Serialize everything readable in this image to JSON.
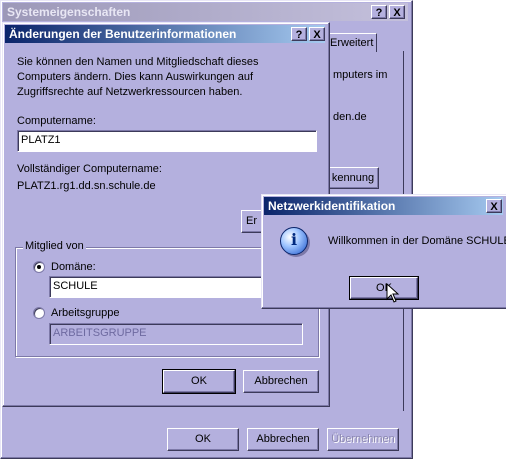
{
  "system_properties": {
    "title": "Systemeigenschaften",
    "help_btn": "?",
    "close_btn": "X",
    "tab_label": "Erweitert",
    "bg_text_1": "mputers im",
    "bg_text_2": "den.de",
    "bg_button": "kennung",
    "ok": "OK",
    "cancel": "Abbrechen",
    "apply": "Übernehmen"
  },
  "user_info_dialog": {
    "title": "Änderungen der Benutzerinformationen",
    "help_btn": "?",
    "close_btn": "X",
    "description": "Sie können den Namen und Mitgliedschaft dieses Computers ändern. Dies kann Auswirkungen auf Zugriffsrechte auf Netzwerkressourcen haben.",
    "computer_name_label": "Computername:",
    "computer_name_value": "PLATZ1",
    "full_name_label": "Vollständiger Computername:",
    "full_name_value": "PLATZ1.rg1.dd.sn.schule.de",
    "more_button": "Er",
    "member_of_label": "Mitglied von",
    "domain_label": "Domäne:",
    "domain_value": "SCHULE",
    "workgroup_label": "Arbeitsgruppe",
    "workgroup_value": "ARBEITSGRUPPE",
    "ok": "OK",
    "cancel": "Abbrechen"
  },
  "network_id_popup": {
    "title": "Netzwerkidentifikation",
    "close_btn": "X",
    "message": "Willkommen in der Domäne SCHULE",
    "ok": "OK",
    "info_icon_glyph": "i"
  }
}
